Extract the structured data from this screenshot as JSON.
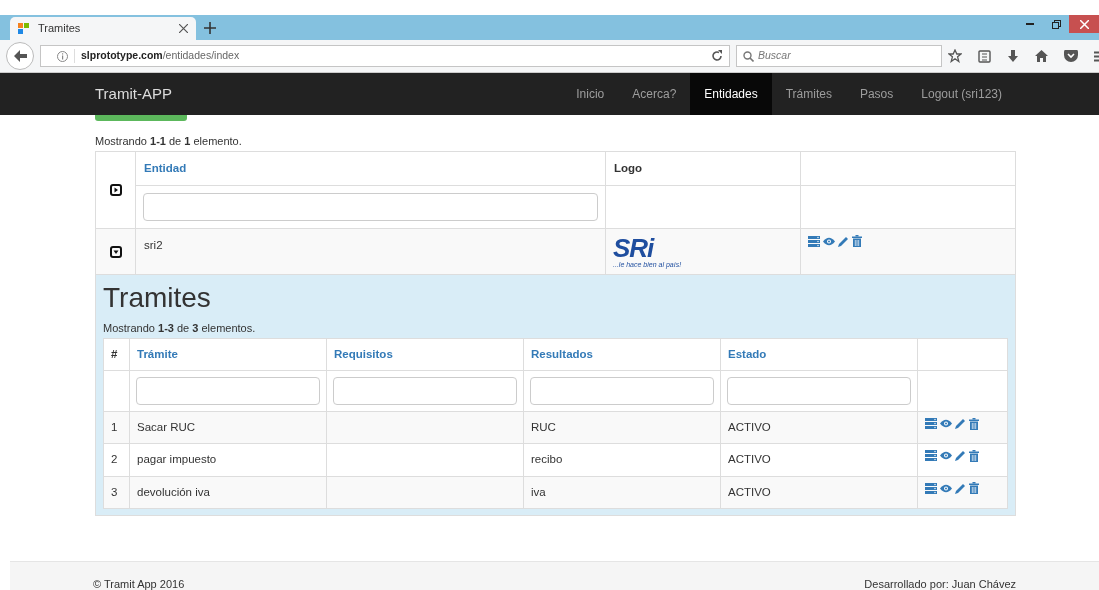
{
  "browser": {
    "tab_title": "Tramites",
    "url_host": "slprototype.com",
    "url_path": "/entidades/index",
    "search_placeholder": "Buscar"
  },
  "navbar": {
    "brand": "Tramit-APP",
    "items": [
      {
        "label": "Inicio",
        "selected": false
      },
      {
        "label": "Acerca?",
        "selected": false
      },
      {
        "label": "Entidades",
        "selected": true
      },
      {
        "label": "Trámites",
        "selected": false
      },
      {
        "label": "Pasos",
        "selected": false
      },
      {
        "label": "Logout (sri123)",
        "selected": false
      }
    ]
  },
  "entities": {
    "summary": "Mostrando **1-1** de **1** elemento.",
    "columns": [
      {
        "label": "Entidad",
        "sortable": true
      },
      {
        "label": "Logo",
        "sortable": false
      }
    ],
    "header_toggle": {
      "expanded": false
    },
    "rows": [
      {
        "expanded": true,
        "name": "sri2",
        "logo": {
          "text": "SRi",
          "tagline": "...le hace bien al país!"
        }
      }
    ]
  },
  "tramites": {
    "title": "Tramites",
    "summary": "Mostrando **1-3** de **3** elementos.",
    "columns": [
      {
        "label": "#",
        "sortable": false
      },
      {
        "label": "Trámite",
        "sortable": true
      },
      {
        "label": "Requisitos",
        "sortable": true
      },
      {
        "label": "Resultados",
        "sortable": true
      },
      {
        "label": "Estado",
        "sortable": true
      }
    ],
    "rows": [
      {
        "number": "1",
        "tramite": "Sacar RUC",
        "resultados": "RUC",
        "estado": "ACTIVO"
      },
      {
        "number": "2",
        "tramite": "pagar impuesto",
        "resultados": "recibo",
        "estado": "ACTIVO"
      },
      {
        "number": "3",
        "tramite": "devolución iva",
        "resultados": "iva",
        "estado": "ACTIVO"
      }
    ]
  },
  "footer": {
    "left": "© Tramit App 2016",
    "right": "Desarrollado por: Juan Chávez"
  }
}
